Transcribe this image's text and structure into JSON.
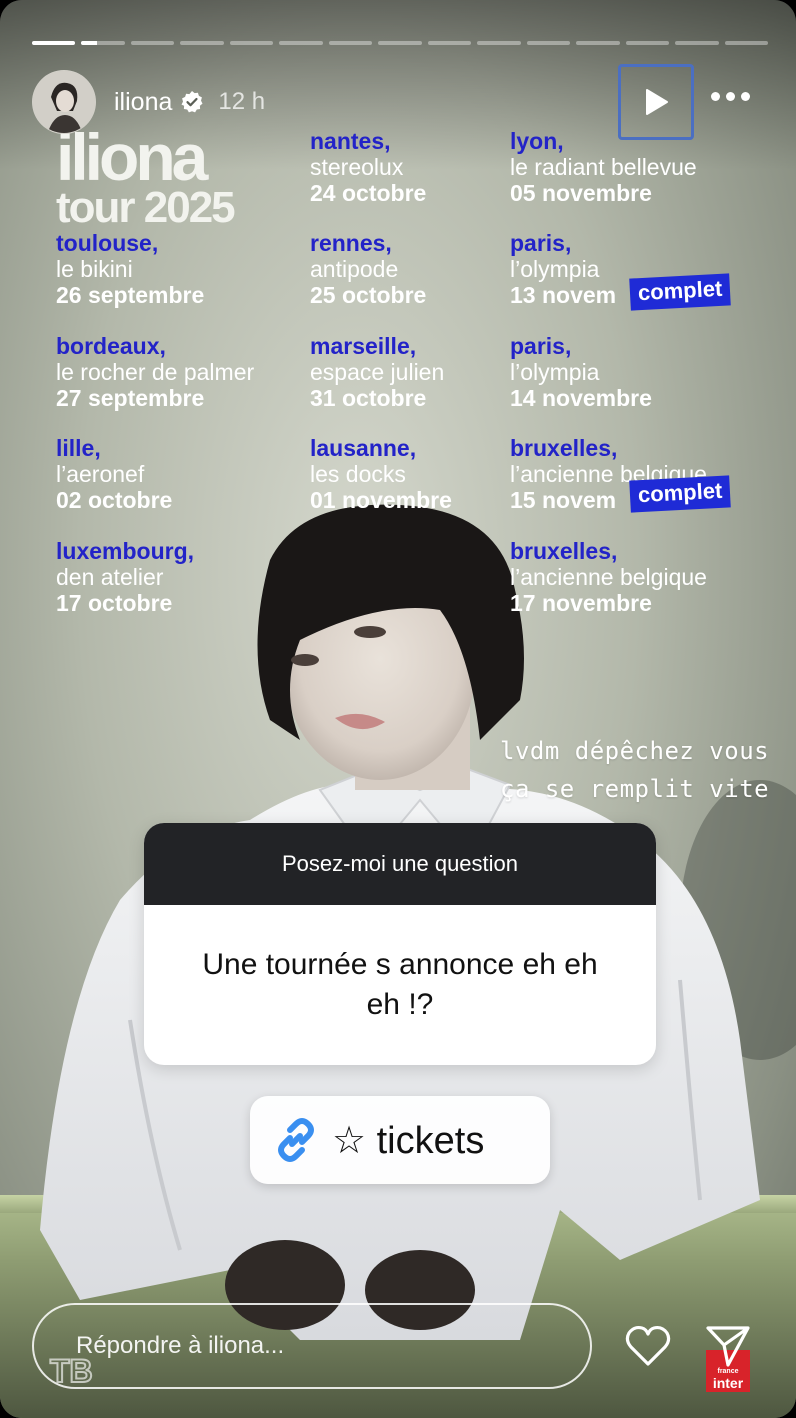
{
  "story": {
    "progress": {
      "segments": 15,
      "active_index": 1,
      "active_fraction": 0.35
    },
    "header": {
      "username": "iliona",
      "timestamp": "12 h",
      "verified": true
    },
    "icons": {
      "play": "play-icon",
      "more": "more-icon",
      "verified": "verified-badge-icon",
      "link": "link-icon",
      "like": "heart-icon",
      "share": "send-icon"
    }
  },
  "poster": {
    "brand_name": "iliona",
    "brand_tour": "tour 2025",
    "venues": [
      {
        "city": "toulouse,",
        "hall": "le bikini",
        "date": "26 septembre"
      },
      {
        "city": "bordeaux,",
        "hall": "le rocher de palmer",
        "date": "27 septembre"
      },
      {
        "city": "lille,",
        "hall": "l’aeronef",
        "date": "02 octobre"
      },
      {
        "city": "luxembourg,",
        "hall": "den atelier",
        "date": "17 octobre"
      },
      {
        "city": "nantes,",
        "hall": "stereolux",
        "date": "24 octobre"
      },
      {
        "city": "rennes,",
        "hall": "antipode",
        "date": "25 octobre"
      },
      {
        "city": "marseille,",
        "hall": "espace julien",
        "date": "31 octobre"
      },
      {
        "city": "lausanne,",
        "hall": "les docks",
        "date": "01 novembre"
      },
      {
        "city": "lyon,",
        "hall": "le radiant bellevue",
        "date": "05 novembre"
      },
      {
        "city": "paris,",
        "hall": "l’olympia",
        "date": "13 novem"
      },
      {
        "city": "paris,",
        "hall": "l’olympia",
        "date": "14 novembre"
      },
      {
        "city": "bruxelles,",
        "hall": "l’ancienne belgique",
        "date": "15 novem"
      },
      {
        "city": "bruxelles,",
        "hall": "l’ancienne belgique",
        "date": "17 novembre"
      }
    ],
    "badges": [
      "complet",
      "complet"
    ],
    "note_line1": "lvdm dépêchez vous",
    "note_line2": "ça se remplit vite"
  },
  "question_sticker": {
    "header": "Posez-moi une question",
    "answer": "Une tournée s annonce eh eh eh !?"
  },
  "link_sticker": {
    "label": "☆ tickets"
  },
  "reply": {
    "placeholder": "Répondre à iliona..."
  },
  "watermark": {
    "left": "TB",
    "right_small": "france",
    "right": "inter"
  },
  "colors": {
    "accent_blue": "#2323c8",
    "badge_blue": "#1f2bd6",
    "sticker_head": "#222326"
  }
}
